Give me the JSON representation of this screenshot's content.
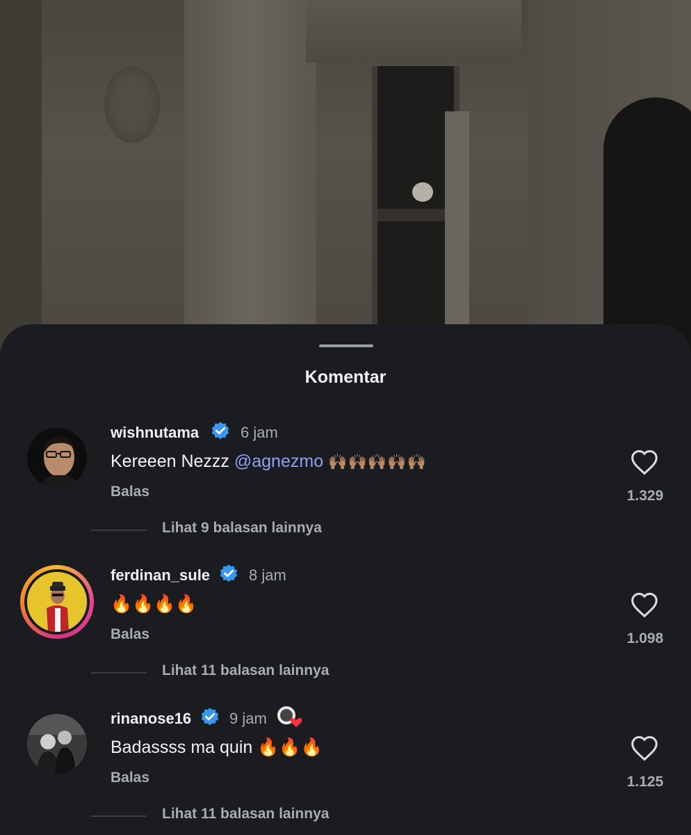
{
  "sheet": {
    "title": "Komentar"
  },
  "comments": [
    {
      "username": "wishnutama",
      "verified": true,
      "time": "6 jam",
      "text": "Kereeen Nezzz ",
      "mention": "@agnezmo",
      "emoji": "🙌🏽🙌🏽🙌🏽🙌🏽🙌🏽",
      "reply_label": "Balas",
      "likes": "1.329",
      "more_replies": "Lihat 9 balasan lainnya"
    },
    {
      "username": "ferdinan_sule",
      "verified": true,
      "time": "8 jam",
      "text": "🔥🔥🔥🔥",
      "reply_label": "Balas",
      "likes": "1.098",
      "more_replies": "Lihat 11 balasan lainnya"
    },
    {
      "username": "rinanose16",
      "verified": true,
      "time": "9 jam",
      "text": "Badassss ma quin 🔥🔥🔥",
      "reply_label": "Balas",
      "likes": "1.125",
      "more_replies": "Lihat 11 balasan lainnya"
    }
  ],
  "colors": {
    "sheet_bg": "#1a1c1f",
    "verified_blue": "#3897f0",
    "mention": "#8ea1f5",
    "muted_text": "#a9adb3"
  },
  "icons": {
    "verified": "verified-badge-icon",
    "like": "heart-outline-icon",
    "creator_liked": "creator-liked-heart-icon"
  }
}
